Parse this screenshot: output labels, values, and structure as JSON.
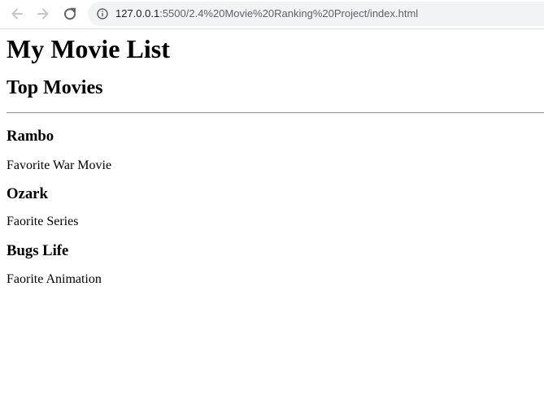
{
  "browser": {
    "url_host": "127.0.0.1",
    "url_rest": ":5500/2.4%20Movie%20Ranking%20Project/index.html"
  },
  "page": {
    "title": "My Movie List",
    "subtitle": "Top Movies",
    "movies": [
      {
        "name": "Rambo",
        "description": "Favorite War Movie"
      },
      {
        "name": "Ozark",
        "description": "Faorite Series"
      },
      {
        "name": "Bugs Life",
        "description": "Faorite Animation"
      }
    ]
  }
}
